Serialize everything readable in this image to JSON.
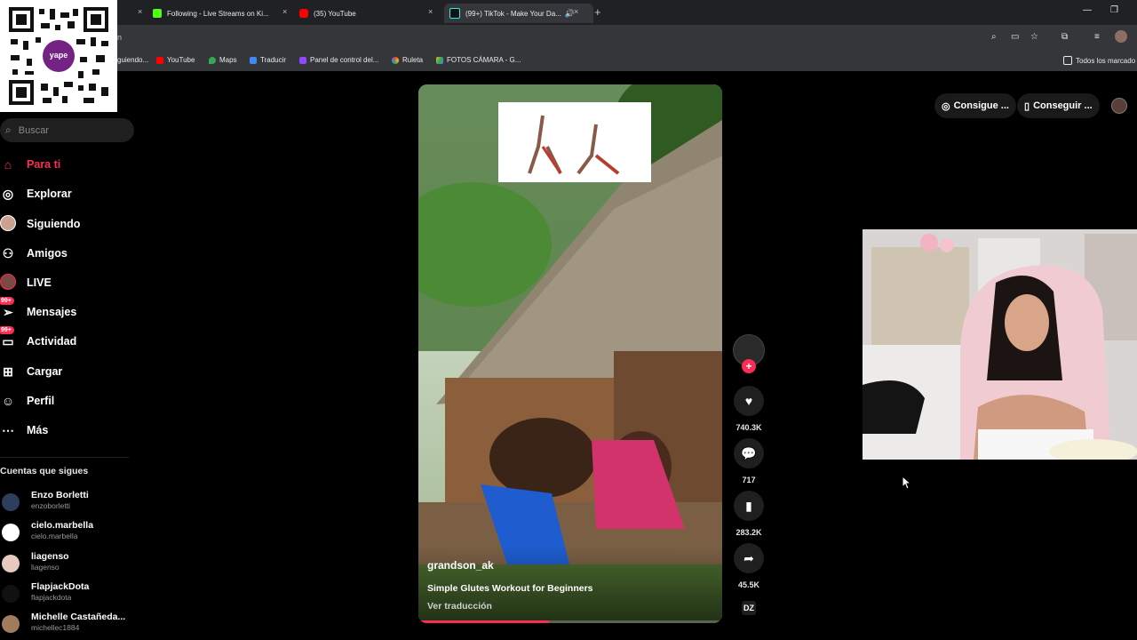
{
  "browser": {
    "tabs": [
      {
        "label": "",
        "close": "×"
      },
      {
        "label": "Following - Live Streams on Ki...",
        "close": "×"
      },
      {
        "label": "(35) YouTube",
        "close": "×"
      },
      {
        "label": "(99+) TikTok - Make Your Da...",
        "close": "×"
      }
    ],
    "new_tab": "+",
    "address_fragment": "n",
    "bookmarks": [
      "guiendo...",
      "YouTube",
      "Maps",
      "Traducir",
      "Panel de control del...",
      "Ruleta",
      "FOTOS CÁMARA - G..."
    ],
    "all_bookmarks": "Todos los marcado"
  },
  "qr": {
    "brand": "yape"
  },
  "sidebar": {
    "search_placeholder": "Buscar",
    "nav": [
      {
        "label": "Para ti",
        "icon": "home-icon"
      },
      {
        "label": "Explorar",
        "icon": "compass-icon"
      },
      {
        "label": "Siguiendo",
        "icon": "following-avatar-icon"
      },
      {
        "label": "Amigos",
        "icon": "friends-icon"
      },
      {
        "label": "LIVE",
        "icon": "live-avatar-icon"
      },
      {
        "label": "Mensajes",
        "icon": "messages-icon",
        "badge": "99+"
      },
      {
        "label": "Actividad",
        "icon": "activity-icon",
        "badge": "99+"
      },
      {
        "label": "Cargar",
        "icon": "upload-icon"
      },
      {
        "label": "Perfil",
        "icon": "profile-icon"
      },
      {
        "label": "Más",
        "icon": "more-icon"
      }
    ],
    "following_title": "Cuentas que sigues",
    "accounts": [
      {
        "name": "Enzo Borletti",
        "handle": "enzoborletti"
      },
      {
        "name": "cielo.marbella",
        "handle": "cielo.marbella"
      },
      {
        "name": "liagenso",
        "handle": "liagenso"
      },
      {
        "name": "FlapjackDota",
        "handle": "flapjackdota"
      },
      {
        "name": "Michelle Castañeda...",
        "handle": "michellec1884"
      }
    ]
  },
  "header": {
    "get_coins": "Consigue ...",
    "get_app": "Conseguir ..."
  },
  "video": {
    "author": "grandson_ak",
    "caption": "Simple Glutes Workout for Beginners",
    "translate": "Ver traducción",
    "progress": 0.43
  },
  "actions": {
    "follow": "+",
    "likes": "740.3K",
    "comments": "717",
    "saves": "283.2K",
    "shares": "45.5K",
    "sound": "DZ"
  }
}
